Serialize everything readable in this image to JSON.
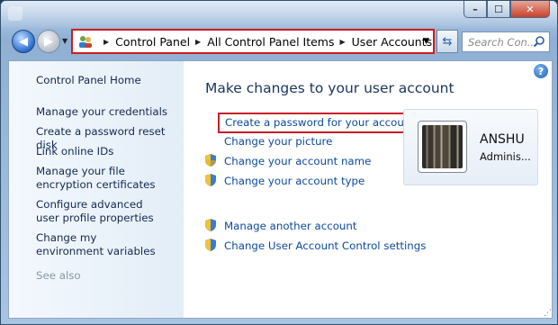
{
  "address": {
    "crumbs": [
      "Control Panel",
      "All Control Panel Items",
      "User Accounts"
    ]
  },
  "search": {
    "placeholder": "Search Con..."
  },
  "sidebar": {
    "home": "Control Panel Home",
    "links": [
      "Manage your credentials",
      "Create a password reset disk",
      "Link online IDs",
      "Manage your file encryption certificates",
      "Configure advanced user profile properties",
      "Change my environment variables"
    ],
    "see_also": "See also"
  },
  "main": {
    "heading": "Make changes to your user account",
    "tasks": [
      "Create a password for your account",
      "Change your picture",
      "Change your account name",
      "Change your account type"
    ],
    "other_tasks": [
      "Manage another account",
      "Change User Account Control settings"
    ]
  },
  "user": {
    "name": "ANSHU",
    "role": "Adminis..."
  },
  "colors": {
    "link": "#0d4a9e",
    "highlight": "#c61e2b",
    "heading": "#19355f"
  },
  "icons": [
    "back-arrow-icon",
    "forward-arrow-icon",
    "users-icon",
    "refresh-icon",
    "search-icon",
    "help-icon",
    "shield-icon"
  ]
}
